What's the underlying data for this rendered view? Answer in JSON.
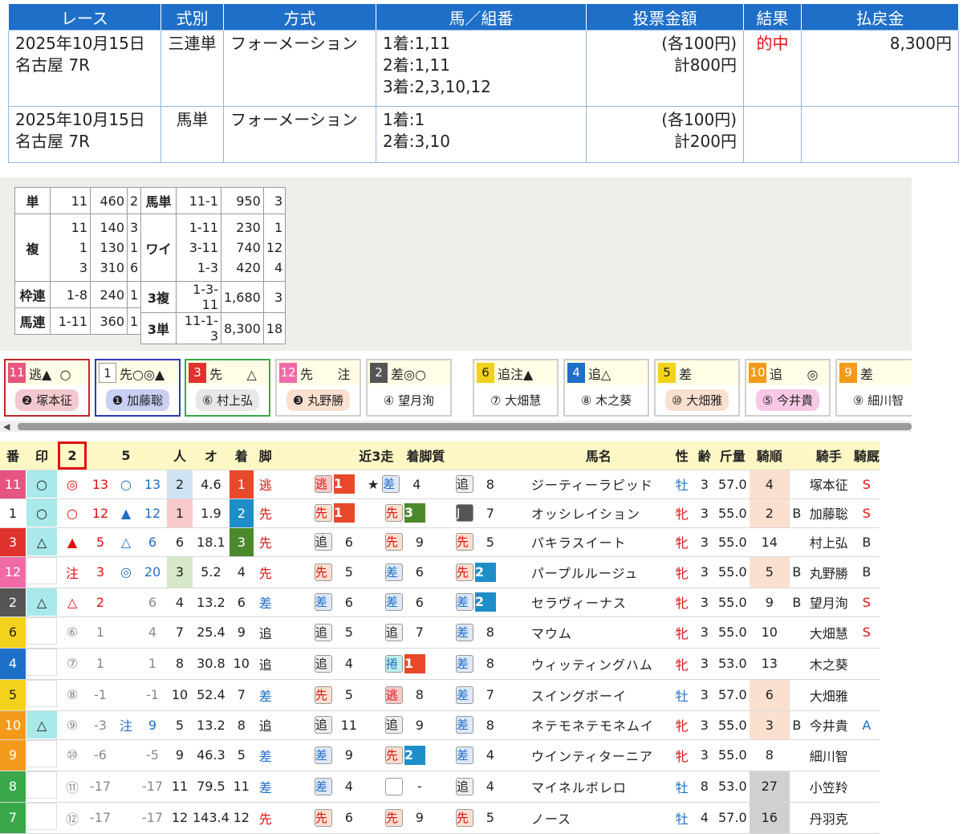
{
  "tickets": {
    "headers": [
      "レース",
      "式別",
      "方式",
      "馬／組番",
      "投票金額",
      "結果",
      "払戻金"
    ],
    "rows": [
      {
        "race": [
          "2025年10月15日",
          "名古屋 7R"
        ],
        "type": "三連単",
        "method": "フォーメーション",
        "combo": [
          "1着:1,11",
          "2着:1,11",
          "3着:2,3,10,12"
        ],
        "amount": [
          "(各100円)",
          "計800円"
        ],
        "result": "的中",
        "payout": "8,300円"
      },
      {
        "race": [
          "2025年10月15日",
          "名古屋 7R"
        ],
        "type": "馬単",
        "method": "フォーメーション",
        "combo": [
          "1着:1",
          "2着:3,10"
        ],
        "amount": [
          "(各100円)",
          "計200円"
        ],
        "result": "",
        "payout": ""
      }
    ]
  },
  "odds": {
    "left": [
      {
        "k": "単",
        "a": [
          "11"
        ],
        "b": [
          "460"
        ],
        "c": [
          "2"
        ]
      },
      {
        "k": "複",
        "a": [
          "11",
          "1",
          "3"
        ],
        "b": [
          "140",
          "130",
          "310"
        ],
        "c": [
          "3",
          "1",
          "6"
        ]
      },
      {
        "k": "枠連",
        "a": [
          "1-8"
        ],
        "b": [
          "240"
        ],
        "c": [
          "1"
        ]
      },
      {
        "k": "馬連",
        "a": [
          "1-11"
        ],
        "b": [
          "360"
        ],
        "c": [
          "1"
        ]
      }
    ],
    "right": [
      {
        "k": "馬単",
        "a": [
          "11-1"
        ],
        "b": [
          "950"
        ],
        "c": [
          "3"
        ]
      },
      {
        "k": "ワイ",
        "a": [
          "1-11",
          "3-11",
          "1-3"
        ],
        "b": [
          "230",
          "740",
          "420"
        ],
        "c": [
          "1",
          "12",
          "4"
        ]
      },
      {
        "k": "3複",
        "a": [
          "1-3-11"
        ],
        "b": [
          "1,680"
        ],
        "c": [
          "3"
        ]
      },
      {
        "k": "3単",
        "a": [
          "11-1-3"
        ],
        "b": [
          "8,300"
        ],
        "c": [
          "18"
        ]
      }
    ]
  },
  "cards": [
    {
      "num": "11",
      "txt": "逃▲  ○",
      "jockey": "❷ 塚本征",
      "bg": "#e75480",
      "bd": "#c0272d",
      "pill": "#f3c9cf"
    },
    {
      "num": "1",
      "txt": "先○◎▲",
      "jockey": "❶ 加藤聡",
      "bg": "#ffffff",
      "bd": "#2d3bb5",
      "pill": "#c9cff3"
    },
    {
      "num": "3",
      "txt": "先      △",
      "jockey": "⑥ 村上弘",
      "bg": "#e0322e",
      "bd": "#3aa84a",
      "pill": "#e7e7e7"
    },
    {
      "num": "12",
      "txt": "先      注",
      "jockey": "❸ 丸野勝",
      "bg": "#f06aa8",
      "bd": "#cfcfcf",
      "pill": "#fbe0d0"
    },
    {
      "num": "2",
      "txt": "差◎○",
      "jockey": "④ 望月洵",
      "bg": "#555555",
      "bd": "#cfcfcf",
      "pill": "#ffffff"
    },
    {
      "num": "6",
      "txt": "追注▲",
      "jockey": "⑦ 大畑慧",
      "bg": "#f3d21b",
      "bd": "#cfcfcf",
      "pill": "#ffffff"
    },
    {
      "num": "4",
      "txt": "追△",
      "jockey": "⑧ 木之葵",
      "bg": "#1e6fc8",
      "bd": "#cfcfcf",
      "pill": "#ffffff"
    },
    {
      "num": "5",
      "txt": "差",
      "jockey": "⑩ 大畑雅",
      "bg": "#f3d21b",
      "bd": "#cfcfcf",
      "pill": "#fbe0d0"
    },
    {
      "num": "10",
      "txt": "追      ◎",
      "jockey": "⑤ 今井貴",
      "bg": "#f39a1b",
      "bd": "#cfcfcf",
      "pill": "#f7c9e6"
    },
    {
      "num": "9",
      "txt": "差",
      "jockey": "⑨ 細川智",
      "bg": "#f39a1b",
      "bd": "#cfcfcf",
      "pill": "#ffffff"
    }
  ],
  "table": {
    "headers": [
      "番",
      "印",
      "2",
      "",
      "5",
      "",
      "人",
      "オ",
      "着",
      "脚",
      "近3走　着脚質",
      "馬名",
      "性",
      "齢",
      "斤量",
      "騎順",
      "",
      "騎手",
      "騎厩"
    ],
    "rows": [
      {
        "ban": "11",
        "bc": "#e75480",
        "mk": "○",
        "mc": "#a9e9ea",
        "m1": "◎",
        "m1c": "red",
        "v1": "13",
        "v1c": "red",
        "m2": "○",
        "m2c": "blue",
        "v2": "13",
        "v2c": "blue",
        "pop": "2",
        "pc": "#cfe3f5",
        "odds": "4.6",
        "fin": "1",
        "fc": "#e8492a",
        "leg": "逃",
        "lc": "red",
        "r": [
          [
            "逃",
            "#f6c9c9",
            "#e01010",
            "1",
            "#e8492a",
            ""
          ],
          [
            "差",
            "#dfe8f6",
            "#1e6fc8",
            "4",
            "",
            "★"
          ],
          [
            "追",
            "#eeeeee",
            "#222",
            "8",
            "",
            ""
          ]
        ],
        "name": "ジーティーラピッド",
        "sex": "牡",
        "sc": "blue",
        "age": "3",
        "kg": "57.0",
        "jr": "4",
        "jrc": "#fbe0d0",
        "bb": "",
        "jk": "塚本征",
        "kk": "S",
        "kc": "red"
      },
      {
        "ban": "1",
        "bc": "#ffffff",
        "mk": "○",
        "mc": "#a9e9ea",
        "m1": "○",
        "m1c": "red",
        "v1": "12",
        "v1c": "red",
        "m2": "▲",
        "m2c": "blue",
        "v2": "12",
        "v2c": "blue",
        "pop": "1",
        "pc": "#f9c9c9",
        "odds": "1.9",
        "fin": "2",
        "fc": "#1e8ec8",
        "leg": "先",
        "lc": "red",
        "r": [
          [
            "先",
            "#fbe0d0",
            "#e01010",
            "1",
            "#e8492a",
            ""
          ],
          [
            "先",
            "#fbe0d0",
            "#e01010",
            "3",
            "#4a8a2a",
            ""
          ],
          [
            "J",
            "#555555",
            "#fff",
            "7",
            "",
            ""
          ]
        ],
        "name": "オッシレイション",
        "sex": "牝",
        "sc": "red",
        "age": "3",
        "kg": "55.0",
        "jr": "2",
        "jrc": "#fbe0d0",
        "bb": "B",
        "jk": "加藤聡",
        "kk": "S",
        "kc": "red"
      },
      {
        "ban": "3",
        "bc": "#e0322e",
        "mk": "△",
        "mc": "#a9e9ea",
        "m1": "▲",
        "m1c": "red",
        "v1": "5",
        "v1c": "red",
        "m2": "△",
        "m2c": "blue",
        "v2": "6",
        "v2c": "blue",
        "pop": "6",
        "pc": "",
        "odds": "18.1",
        "fin": "3",
        "fc": "#4a8a2a",
        "leg": "先",
        "lc": "red",
        "r": [
          [
            "追",
            "#eeeeee",
            "#222",
            "6",
            "",
            ""
          ],
          [
            "先",
            "#fbe0d0",
            "#e01010",
            "9",
            "",
            ""
          ],
          [
            "先",
            "#fbe0d0",
            "#e01010",
            "5",
            "",
            ""
          ]
        ],
        "name": "パキラスイート",
        "sex": "牝",
        "sc": "red",
        "age": "3",
        "kg": "55.0",
        "jr": "14",
        "jrc": "",
        "bb": "",
        "jk": "村上弘",
        "kk": "B",
        "kc": ""
      },
      {
        "ban": "12",
        "bc": "#f06aa8",
        "mk": "",
        "mc": "",
        "m1": "注",
        "m1c": "red",
        "v1": "3",
        "v1c": "red",
        "m2": "◎",
        "m2c": "blue",
        "v2": "20",
        "v2c": "blue",
        "pop": "3",
        "pc": "#d6e8c8",
        "odds": "5.2",
        "fin": "4",
        "fc": "",
        "leg": "先",
        "lc": "red",
        "r": [
          [
            "先",
            "#fbe0d0",
            "#e01010",
            "5",
            "",
            ""
          ],
          [
            "差",
            "#dfe8f6",
            "#1e6fc8",
            "6",
            "",
            ""
          ],
          [
            "先",
            "#fbe0d0",
            "#e01010",
            "2",
            "#1e8ec8",
            ""
          ]
        ],
        "name": "パープルルージュ",
        "sex": "牝",
        "sc": "red",
        "age": "3",
        "kg": "55.0",
        "jr": "5",
        "jrc": "#fbe0d0",
        "bb": "B",
        "jk": "丸野勝",
        "kk": "B",
        "kc": ""
      },
      {
        "ban": "2",
        "bc": "#555555",
        "mk": "△",
        "mc": "#a9e9ea",
        "m1": "△",
        "m1c": "red",
        "v1": "2",
        "v1c": "red",
        "m2": "",
        "m2c": "",
        "v2": "6",
        "v2c": "gray",
        "pop": "4",
        "pc": "",
        "odds": "13.2",
        "fin": "6",
        "fc": "",
        "leg": "差",
        "lc": "blue",
        "r": [
          [
            "差",
            "#dfe8f6",
            "#1e6fc8",
            "6",
            "",
            ""
          ],
          [
            "差",
            "#dfe8f6",
            "#1e6fc8",
            "6",
            "",
            ""
          ],
          [
            "差",
            "#dfe8f6",
            "#1e6fc8",
            "2",
            "#1e8ec8",
            ""
          ]
        ],
        "name": "セラヴィーナス",
        "sex": "牝",
        "sc": "red",
        "age": "3",
        "kg": "55.0",
        "jr": "9",
        "jrc": "",
        "bb": "B",
        "jk": "望月洵",
        "kk": "S",
        "kc": "red"
      },
      {
        "ban": "6",
        "bc": "#f3d21b",
        "mk": "",
        "mc": "",
        "m1": "⑥",
        "m1c": "gray",
        "v1": "1",
        "v1c": "gray",
        "m2": "",
        "m2c": "",
        "v2": "4",
        "v2c": "gray",
        "pop": "7",
        "pc": "",
        "odds": "25.4",
        "fin": "9",
        "fc": "",
        "leg": "追",
        "lc": "",
        "r": [
          [
            "追",
            "#eeeeee",
            "#222",
            "5",
            "",
            ""
          ],
          [
            "追",
            "#eeeeee",
            "#222",
            "7",
            "",
            ""
          ],
          [
            "差",
            "#dfe8f6",
            "#1e6fc8",
            "8",
            "",
            ""
          ]
        ],
        "name": "マウム",
        "sex": "牝",
        "sc": "red",
        "age": "3",
        "kg": "55.0",
        "jr": "10",
        "jrc": "",
        "bb": "",
        "jk": "大畑慧",
        "kk": "S",
        "kc": "red"
      },
      {
        "ban": "4",
        "bc": "#1e6fc8",
        "mk": "",
        "mc": "",
        "m1": "⑦",
        "m1c": "gray",
        "v1": "1",
        "v1c": "gray",
        "m2": "",
        "m2c": "",
        "v2": "1",
        "v2c": "gray",
        "pop": "8",
        "pc": "",
        "odds": "30.8",
        "fin": "10",
        "fc": "",
        "leg": "追",
        "lc": "",
        "r": [
          [
            "追",
            "#eeeeee",
            "#222",
            "4",
            "",
            ""
          ],
          [
            "捲",
            "#bff0e8",
            "#1e6fc8",
            "1",
            "#e8492a",
            ""
          ],
          [
            "差",
            "#dfe8f6",
            "#1e6fc8",
            "8",
            "",
            ""
          ]
        ],
        "name": "ウィッティングハム",
        "sex": "牝",
        "sc": "red",
        "age": "3",
        "kg": "53.0",
        "jr": "13",
        "jrc": "",
        "bb": "",
        "jk": "木之葵",
        "kk": "",
        "kc": ""
      },
      {
        "ban": "5",
        "bc": "#f3d21b",
        "mk": "",
        "mc": "",
        "m1": "⑧",
        "m1c": "gray",
        "v1": "-1",
        "v1c": "gray",
        "m2": "",
        "m2c": "",
        "v2": "-1",
        "v2c": "gray",
        "pop": "10",
        "pc": "",
        "odds": "52.4",
        "fin": "7",
        "fc": "",
        "leg": "差",
        "lc": "blue",
        "r": [
          [
            "先",
            "#fbe0d0",
            "#e01010",
            "5",
            "",
            ""
          ],
          [
            "逃",
            "#f6c9c9",
            "#e01010",
            "8",
            "",
            ""
          ],
          [
            "差",
            "#dfe8f6",
            "#1e6fc8",
            "7",
            "",
            ""
          ]
        ],
        "name": "スイングボーイ",
        "sex": "牡",
        "sc": "blue",
        "age": "3",
        "kg": "57.0",
        "jr": "6",
        "jrc": "#fbe0d0",
        "bb": "",
        "jk": "大畑雅",
        "kk": "",
        "kc": ""
      },
      {
        "ban": "10",
        "bc": "#f39a1b",
        "mk": "△",
        "mc": "#a9e9ea",
        "m1": "⑨",
        "m1c": "gray",
        "v1": "-3",
        "v1c": "gray",
        "m2": "注",
        "m2c": "blue",
        "v2": "9",
        "v2c": "blue",
        "pop": "5",
        "pc": "",
        "odds": "13.2",
        "fin": "8",
        "fc": "",
        "leg": "追",
        "lc": "",
        "r": [
          [
            "追",
            "#eeeeee",
            "#222",
            "11",
            "",
            ""
          ],
          [
            "追",
            "#eeeeee",
            "#222",
            "9",
            "",
            ""
          ],
          [
            "差",
            "#dfe8f6",
            "#1e6fc8",
            "8",
            "",
            ""
          ]
        ],
        "name": "ネテモネテモネムイ",
        "sex": "牝",
        "sc": "red",
        "age": "3",
        "kg": "55.0",
        "jr": "3",
        "jrc": "#fbe0d0",
        "bb": "B",
        "jk": "今井貴",
        "kk": "A",
        "kc": "blue"
      },
      {
        "ban": "9",
        "bc": "#f39a1b",
        "mk": "",
        "mc": "",
        "m1": "⑩",
        "m1c": "gray",
        "v1": "-6",
        "v1c": "gray",
        "m2": "",
        "m2c": "",
        "v2": "-5",
        "v2c": "gray",
        "pop": "9",
        "pc": "",
        "odds": "46.3",
        "fin": "5",
        "fc": "",
        "leg": "差",
        "lc": "blue",
        "r": [
          [
            "差",
            "#dfe8f6",
            "#1e6fc8",
            "9",
            "",
            ""
          ],
          [
            "先",
            "#fbe0d0",
            "#e01010",
            "2",
            "#1e8ec8",
            ""
          ],
          [
            "差",
            "#dfe8f6",
            "#1e6fc8",
            "4",
            "",
            ""
          ]
        ],
        "name": "ウインティターニア",
        "sex": "牝",
        "sc": "red",
        "age": "3",
        "kg": "55.0",
        "jr": "8",
        "jrc": "",
        "bb": "",
        "jk": "細川智",
        "kk": "",
        "kc": ""
      },
      {
        "ban": "8",
        "bc": "#3aa84a",
        "mk": "",
        "mc": "",
        "m1": "⑪",
        "m1c": "gray",
        "v1": "-17",
        "v1c": "gray",
        "m2": "",
        "m2c": "",
        "v2": "-17",
        "v2c": "gray",
        "pop": "11",
        "pc": "",
        "odds": "79.5",
        "fin": "11",
        "fc": "",
        "leg": "差",
        "lc": "blue",
        "r": [
          [
            "差",
            "#dfe8f6",
            "#1e6fc8",
            "4",
            "",
            ""
          ],
          [
            "",
            "#ffffff",
            "#222",
            "-",
            "",
            ""
          ],
          [
            "追",
            "#eeeeee",
            "#222",
            "4",
            "",
            ""
          ]
        ],
        "name": "マイネルボレロ",
        "sex": "牡",
        "sc": "blue",
        "age": "8",
        "kg": "53.0",
        "jr": "27",
        "jrc": "#d0d0d0",
        "bb": "",
        "jk": "小笠羚",
        "kk": "",
        "kc": ""
      },
      {
        "ban": "7",
        "bc": "#3aa84a",
        "mk": "",
        "mc": "",
        "m1": "⑫",
        "m1c": "gray",
        "v1": "-17",
        "v1c": "gray",
        "m2": "",
        "m2c": "",
        "v2": "-17",
        "v2c": "gray",
        "pop": "12",
        "pc": "",
        "odds": "143.4",
        "fin": "12",
        "fc": "",
        "leg": "先",
        "lc": "red",
        "r": [
          [
            "先",
            "#fbe0d0",
            "#e01010",
            "6",
            "",
            ""
          ],
          [
            "先",
            "#fbe0d0",
            "#e01010",
            "9",
            "",
            ""
          ],
          [
            "先",
            "#fbe0d0",
            "#e01010",
            "5",
            "",
            ""
          ]
        ],
        "name": "ノース",
        "sex": "牡",
        "sc": "blue",
        "age": "4",
        "kg": "57.0",
        "jr": "16",
        "jrc": "#d0d0d0",
        "bb": "",
        "jk": "丹羽克",
        "kk": "",
        "kc": ""
      }
    ]
  }
}
